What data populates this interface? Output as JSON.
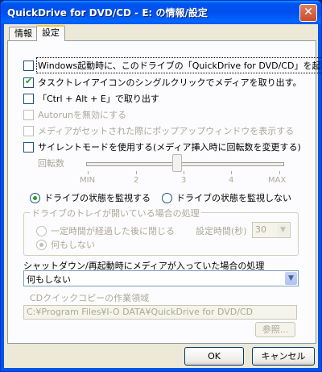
{
  "window": {
    "title": "QuickDrive for DVD/CD - E: の情報/設定",
    "close": "✕"
  },
  "tabs": [
    {
      "label": "情報"
    },
    {
      "label": "設定"
    }
  ],
  "options": {
    "startup": {
      "label": "Windows起動時に、このドライブの「QuickDrive for DVD/CD」を起動する",
      "checked": false
    },
    "tray_eject": {
      "label": "タスクトレイアイコンのシングルクリックでメディアを取り出す。",
      "checked": true
    },
    "hotkey_eject": {
      "label": "「Ctrl + Alt + E」で取り出す",
      "checked": false
    },
    "disable_autorun": {
      "label": "Autorunを無効にする",
      "checked": false
    },
    "popup_on_insert": {
      "label": "メディアがセットされた際にポップアップウィンドウを表示する",
      "checked": false
    },
    "silent_mode": {
      "label": "サイレントモードを使用する(メディア挿入時に回転数を変更する)",
      "checked": false
    }
  },
  "rotation": {
    "label": "回転数",
    "ticks": [
      "MIN",
      "2",
      "3",
      "4",
      "MAX"
    ],
    "value": 3
  },
  "monitor": {
    "on_label": "ドライブの状態を監視する",
    "off_label": "ドライブの状態を監視しない",
    "selected": "on"
  },
  "tray_open": {
    "title": "ドライブのトレイが開いている場合の処理",
    "close_after": "一定時間が経過した後に閉じる",
    "do_nothing": "何もしない",
    "time_label": "設定時間(秒)",
    "time_value": "30"
  },
  "shutdown": {
    "label": "シャットダウン/再起動時にメディアが入っていた場合の処理",
    "value": "何もしない"
  },
  "cdcopy": {
    "label": "CDクイックコピーの作業領域",
    "path": "C:¥Program Files¥I-O DATA¥QuickDrive for DVD/CD",
    "browse": "参照..."
  },
  "buttons": {
    "ok": "OK",
    "cancel": "キャンセル"
  }
}
